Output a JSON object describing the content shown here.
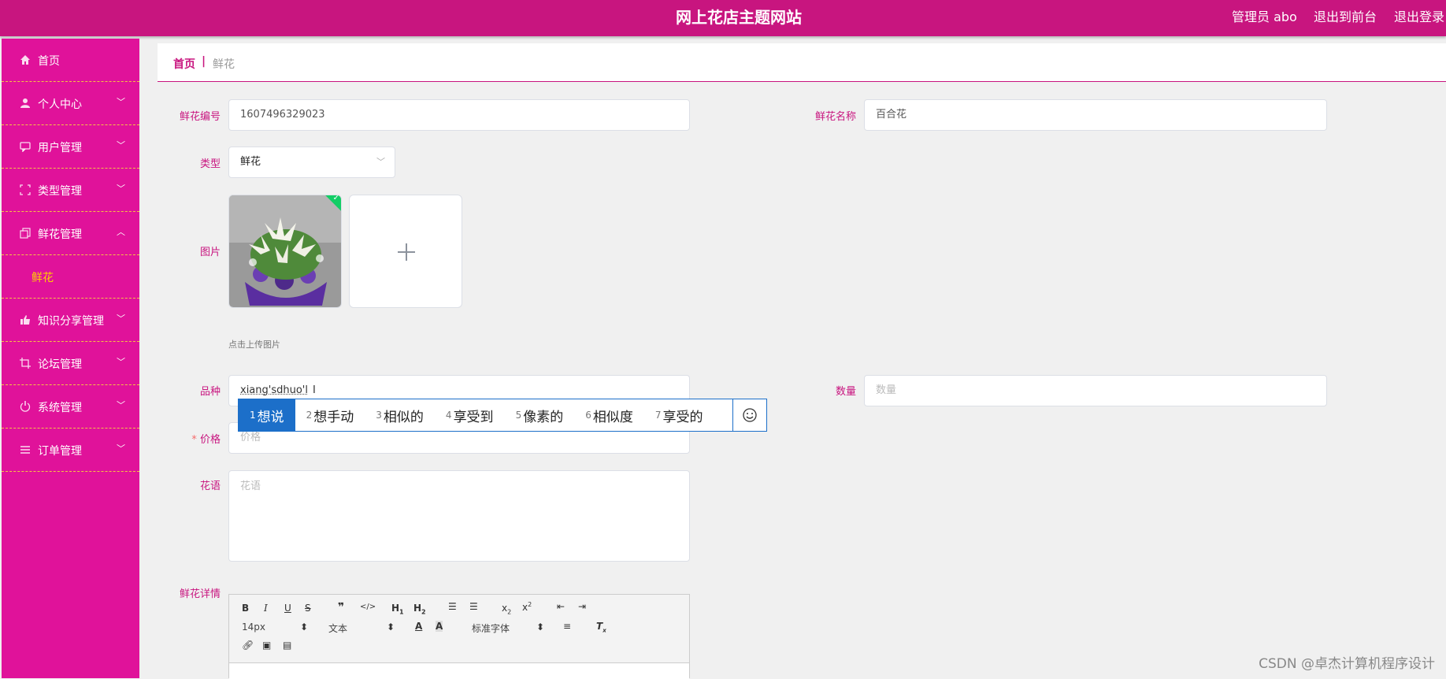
{
  "header": {
    "title": "网上花店主题网站",
    "admin": "管理员 abo",
    "to_front": "退出到前台",
    "logout": "退出登录"
  },
  "sidebar": {
    "items": [
      {
        "label": "首页",
        "icon": "home-icon"
      },
      {
        "label": "个人中心",
        "icon": "user-icon"
      },
      {
        "label": "用户管理",
        "icon": "chat-icon"
      },
      {
        "label": "类型管理",
        "icon": "frame-icon"
      },
      {
        "label": "鲜花管理",
        "icon": "copy-icon"
      },
      {
        "label": "鲜花",
        "icon": ""
      },
      {
        "label": "知识分享管理",
        "icon": "thumb-icon"
      },
      {
        "label": "论坛管理",
        "icon": "crop-icon"
      },
      {
        "label": "系统管理",
        "icon": "power-icon"
      },
      {
        "label": "订单管理",
        "icon": "list-icon"
      }
    ]
  },
  "breadcrumb": {
    "home": "首页",
    "separator": "|",
    "current": "鲜花"
  },
  "form": {
    "code_label": "鲜花编号",
    "code_value": "1607496329023",
    "name_label": "鲜花名称",
    "name_value": "百合花",
    "type_label": "类型",
    "type_value": "鲜花",
    "image_label": "图片",
    "upload_hint": "点击上传图片",
    "variety_label": "品种",
    "variety_value": "xiang'sdhuo'l",
    "qty_label": "数量",
    "qty_placeholder": "数量",
    "price_required": "*",
    "price_label": "价格",
    "price_placeholder": "价格",
    "flower_lang_label": "花语",
    "flower_lang_placeholder": "花语",
    "detail_label": "鲜花详情"
  },
  "ime": {
    "candidates": [
      {
        "n": "1",
        "text": "想说"
      },
      {
        "n": "2",
        "text": "想手动"
      },
      {
        "n": "3",
        "text": "相似的"
      },
      {
        "n": "4",
        "text": "享受到"
      },
      {
        "n": "5",
        "text": "像素的"
      },
      {
        "n": "6",
        "text": "相似度"
      },
      {
        "n": "7",
        "text": "享受的"
      }
    ],
    "selected": 0
  },
  "editor": {
    "font_size": "14px",
    "block_type": "文本",
    "font_family": "标准字体"
  },
  "watermark": "CSDN @卓杰计算机程序设计",
  "colors": {
    "brand": "#c8157f",
    "sidebar": "#e0129a",
    "submenu_active": "#ffd000",
    "ime_blue": "#1c6fc9"
  }
}
